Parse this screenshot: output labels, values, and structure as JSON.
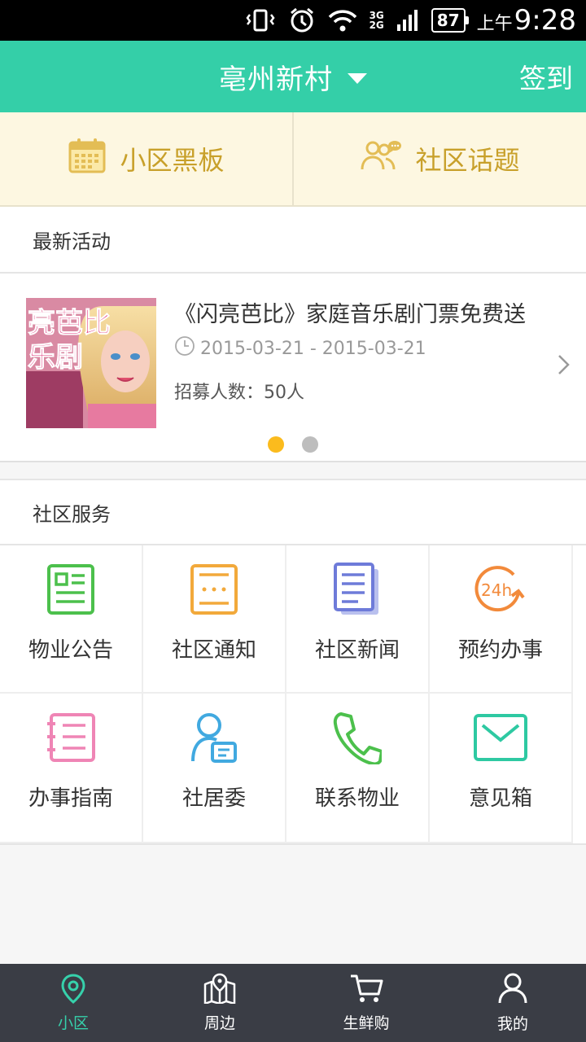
{
  "status_bar": {
    "network_top": "3G",
    "network_bottom": "2G",
    "battery": "87",
    "ampm": "上午",
    "time": "9:28"
  },
  "header": {
    "title": "亳州新村",
    "checkin_label": "签到",
    "accent_color": "#34cfa8"
  },
  "quick_links": [
    {
      "label": "小区黑板",
      "icon": "calendar-icon"
    },
    {
      "label": "社区话题",
      "icon": "people-chat-icon"
    }
  ],
  "latest_activity": {
    "section_title": "最新活动",
    "item": {
      "poster_text_line1": "亮芭比",
      "poster_text_line2": "乐剧",
      "title": "《闪亮芭比》家庭音乐剧门票免费送",
      "date_range": "2015-03-21 - 2015-03-21",
      "recruit_count": "招募人数：50人"
    },
    "pager": {
      "total": 2,
      "current": 1
    }
  },
  "community_services": {
    "section_title": "社区服务",
    "items": [
      {
        "label": "物业公告",
        "icon": "notice-board-icon",
        "color": "#4cc04c"
      },
      {
        "label": "社区通知",
        "icon": "notification-icon",
        "color": "#f2a93b"
      },
      {
        "label": "社区新闻",
        "icon": "news-icon",
        "color": "#6e7bd9"
      },
      {
        "label": "预约办事",
        "icon": "24h-clock-icon",
        "color": "#f28a3b"
      },
      {
        "label": "办事指南",
        "icon": "guide-list-icon",
        "color": "#ef85b5"
      },
      {
        "label": "社居委",
        "icon": "resident-committee-icon",
        "color": "#41a9e0"
      },
      {
        "label": "联系物业",
        "icon": "phone-icon",
        "color": "#4cc04c"
      },
      {
        "label": "意见箱",
        "icon": "mail-icon",
        "color": "#2ec9a2"
      }
    ]
  },
  "bottom_nav": [
    {
      "label": "小区",
      "icon": "location-pin-icon",
      "active": true
    },
    {
      "label": "周边",
      "icon": "map-pin-icon",
      "active": false
    },
    {
      "label": "生鲜购",
      "icon": "cart-icon",
      "active": false
    },
    {
      "label": "我的",
      "icon": "user-icon",
      "active": false
    }
  ]
}
